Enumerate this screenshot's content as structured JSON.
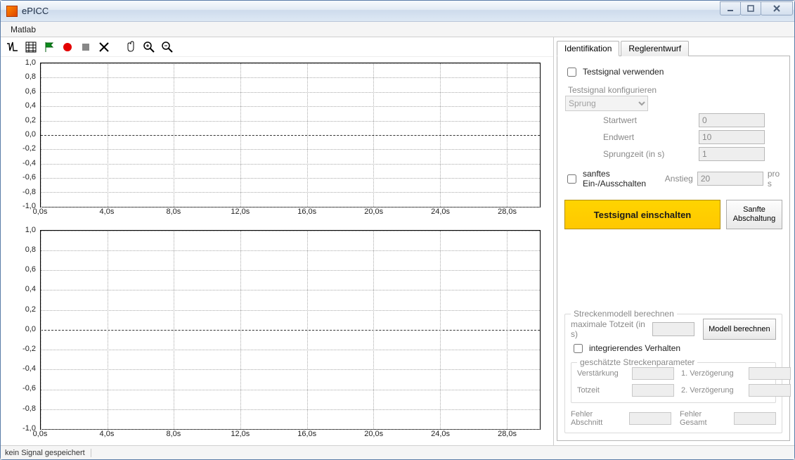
{
  "app_title": "ePICC",
  "menu": {
    "item1": "Matlab"
  },
  "toolbar_icons": {
    "signal": "signal-icon",
    "config": "config-icon",
    "flag": "flag-icon",
    "record": "record-icon",
    "stop": "stop-icon",
    "cut": "cut-icon",
    "hand": "hand-icon",
    "zoom_in": "zoom-in-icon",
    "zoom_out": "zoom-out-icon"
  },
  "chart_data": [
    {
      "type": "line",
      "title": "",
      "xlabel": "",
      "ylabel": "",
      "xlim": [
        0,
        30
      ],
      "ylim": [
        -1.0,
        1.0
      ],
      "x_ticks": [
        "0,0s",
        "4,0s",
        "8,0s",
        "12,0s",
        "16,0s",
        "20,0s",
        "24,0s",
        "28,0s"
      ],
      "y_ticks": [
        "1,0",
        "0,8",
        "0,6",
        "0,4",
        "0,2",
        "0,0",
        "-0,2",
        "-0,4",
        "-0,6",
        "-0,8",
        "-1,0"
      ],
      "series": []
    },
    {
      "type": "line",
      "title": "",
      "xlabel": "",
      "ylabel": "",
      "xlim": [
        0,
        30
      ],
      "ylim": [
        -1.0,
        1.0
      ],
      "x_ticks": [
        "0,0s",
        "4,0s",
        "8,0s",
        "12,0s",
        "16,0s",
        "20,0s",
        "24,0s",
        "28,0s"
      ],
      "y_ticks": [
        "1,0",
        "0,8",
        "0,6",
        "0,4",
        "0,2",
        "0,0",
        "-0,2",
        "-0,4",
        "-0,6",
        "-0,8",
        "-1,0"
      ],
      "series": []
    }
  ],
  "tabs": {
    "ident": "Identifikation",
    "regler": "Reglerentwurf"
  },
  "panel": {
    "use_testsignal": "Testsignal verwenden",
    "config_legend": "Testsignal konfigurieren",
    "signal_type": "Sprung",
    "start_label": "Startwert",
    "start_val": "0",
    "end_label": "Endwert",
    "end_val": "10",
    "time_label": "Sprungzeit (in s)",
    "time_val": "1",
    "soft_label": "sanftes Ein-/Ausschalten",
    "anstieg_label": "Anstieg",
    "anstieg_val": "20",
    "anstieg_unit": "pro s",
    "btn_on": "Testsignal einschalten",
    "btn_soft_off": "Sanfte Abschaltung",
    "model_legend": "Streckenmodell berechnen",
    "deadtime_label": "maximale Totzeit (in s)",
    "btn_model": "Modell berechnen",
    "integr_label": "integrierendes Verhalten",
    "params_legend": "geschätzte Streckenparameter",
    "gain_label": "Verstärkung",
    "delay1_label": "1. Verzögerung",
    "dead_label": "Totzeit",
    "delay2_label": "2. Verzögerung",
    "err_seg_label": "Fehler Abschnitt",
    "err_tot_label": "Fehler Gesamt"
  },
  "status": {
    "msg": "kein Signal gespeichert"
  }
}
